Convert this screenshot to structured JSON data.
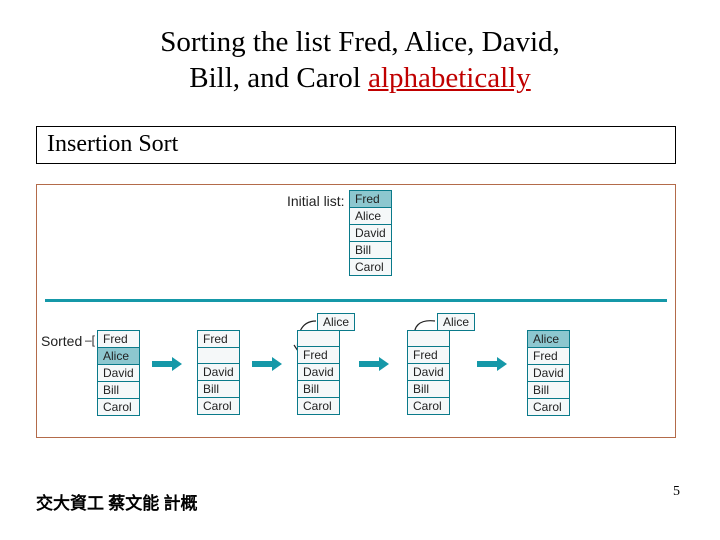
{
  "title": {
    "line1_prefix": "Sorting the list Fred, Alice, David,",
    "line2_prefix": "Bill, and Carol ",
    "line2_accent": "alphabetically"
  },
  "subtitle": "Insertion Sort",
  "diagram": {
    "initial_label": "Initial list:",
    "sorted_label": "Sorted",
    "initial_list": [
      "Fred",
      "Alice",
      "David",
      "Bill",
      "Carol"
    ],
    "steps": {
      "s0": {
        "pivot": null,
        "list": [
          "Fred",
          "Alice",
          "David",
          "Bill",
          "Carol"
        ],
        "teal_idx": 1
      },
      "s1": {
        "pivot": null,
        "list": [
          "Fred",
          "",
          "David",
          "Bill",
          "Carol"
        ]
      },
      "s2": {
        "pivot": "Alice",
        "list": [
          "",
          "Fred",
          "David",
          "Bill",
          "Carol"
        ]
      },
      "s3": {
        "pivot": "Alice",
        "list": [
          "",
          "Fred",
          "David",
          "Bill",
          "Carol"
        ]
      },
      "s4": {
        "pivot": null,
        "list": [
          "Alice",
          "Fred",
          "David",
          "Bill",
          "Carol"
        ],
        "teal_idx": 0
      }
    }
  },
  "footer": "交大資工 蔡文能 計概",
  "page_number": "5"
}
